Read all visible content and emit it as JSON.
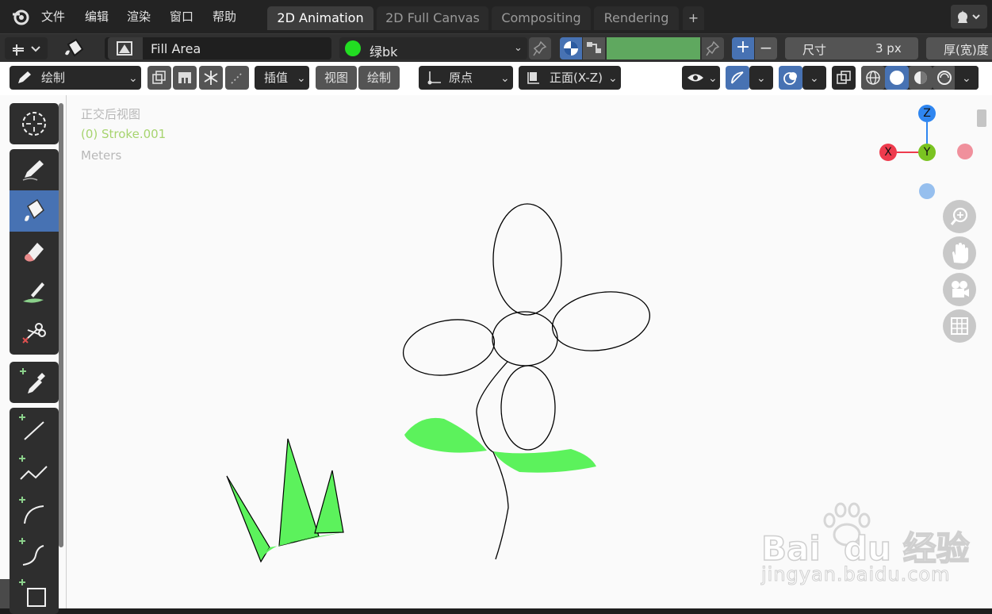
{
  "menubar": {
    "items": [
      "文件",
      "编辑",
      "渲染",
      "窗口",
      "帮助"
    ],
    "tabs": [
      "2D Animation",
      "2D Full Canvas",
      "Compositing",
      "Rendering"
    ],
    "active_tab": "2D Animation",
    "add_tab": "+"
  },
  "tool_settings": {
    "fill_mode": "Fill Area",
    "material": "绿bk",
    "material_color": "#22dd22",
    "swatch_color": "#5fa85f",
    "size_label": "尺寸",
    "size_value": "3 px",
    "thickness_label": "厚(宽)度",
    "plus": "+",
    "minus": "−"
  },
  "header": {
    "mode": "绘制",
    "interpolate": "插值",
    "view_menu": "视图",
    "draw_menu": "绘制",
    "origin": "原点",
    "drawing_plane": "正面(X-Z)"
  },
  "viewport": {
    "view_name": "正交后视图",
    "object_name": "(0) Stroke.001",
    "units": "Meters",
    "fill_color": "#5cf25c",
    "stroke_color": "#000000"
  },
  "gizmo": {
    "z": "Z",
    "x": "X",
    "y": "Y",
    "z_color": "#2f86f0",
    "x_color": "#ee3b4d",
    "y_color": "#7ac321"
  },
  "watermark": {
    "brand": "Bai  du 经验",
    "url": "jingyan.baidu.com"
  }
}
